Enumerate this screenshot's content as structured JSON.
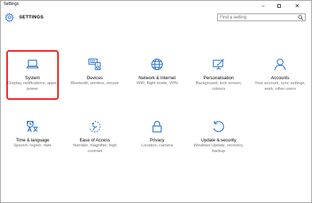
{
  "window": {
    "title": "Settings",
    "controls": {
      "minimize": "–",
      "close": "✕"
    }
  },
  "header": {
    "title": "SETTINGS",
    "search_placeholder": "Find a setting"
  },
  "colors": {
    "accent": "#1b6ac9",
    "highlight": "#e11111"
  },
  "tiles": [
    {
      "label": "System",
      "desc": "Display, notifications, apps, power",
      "icon": "laptop-icon"
    },
    {
      "label": "Devices",
      "desc": "Bluetooth, printers, mouse",
      "icon": "keyboard-speaker-icon"
    },
    {
      "label": "Network & Internet",
      "desc": "WiFi, flight mode, VPN",
      "icon": "globe-icon"
    },
    {
      "label": "Personalisation",
      "desc": "Background, lock screen, colours",
      "icon": "paint-monitor-icon"
    },
    {
      "label": "Accounts",
      "desc": "Your account, sync settings, work, other users",
      "icon": "person-icon"
    },
    {
      "label": "Time & language",
      "desc": "Speech, region, date",
      "icon": "time-language-icon"
    },
    {
      "label": "Ease of Access",
      "desc": "Narrator, magnifier, high contrast",
      "icon": "ease-of-access-icon"
    },
    {
      "label": "Privacy",
      "desc": "Location, camera",
      "icon": "lock-icon"
    },
    {
      "label": "Update & security",
      "desc": "Windows Update, recovery, backup",
      "icon": "update-icon"
    }
  ]
}
